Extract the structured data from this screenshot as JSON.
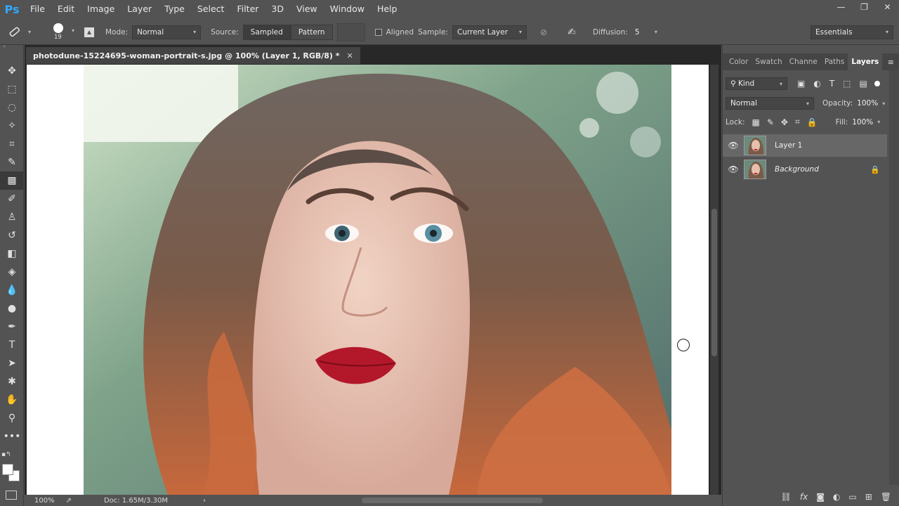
{
  "app": {
    "logo": "Ps"
  },
  "menu": [
    "File",
    "Edit",
    "Image",
    "Layer",
    "Type",
    "Select",
    "Filter",
    "3D",
    "View",
    "Window",
    "Help"
  ],
  "window_controls": {
    "minimize": "—",
    "maximize": "❐",
    "close": "✕"
  },
  "options": {
    "brush_size": "19",
    "mode_label": "Mode:",
    "mode_value": "Normal",
    "source_label": "Source:",
    "sampled": "Sampled",
    "pattern": "Pattern",
    "aligned_label": "Aligned",
    "sample_label": "Sample:",
    "sample_value": "Current Layer",
    "diffusion_label": "Diffusion:",
    "diffusion_value": "5",
    "workspace": "Essentials"
  },
  "tools": [
    {
      "name": "move-tool",
      "glyph": "✥"
    },
    {
      "name": "marquee-tool",
      "glyph": "⬚"
    },
    {
      "name": "lasso-tool",
      "glyph": "◌"
    },
    {
      "name": "quick-select-tool",
      "glyph": "✧"
    },
    {
      "name": "crop-tool",
      "glyph": "⌗"
    },
    {
      "name": "eyedropper-tool",
      "glyph": "✎"
    },
    {
      "name": "healing-brush-tool",
      "glyph": "▩"
    },
    {
      "name": "brush-tool",
      "glyph": "✐"
    },
    {
      "name": "clone-stamp-tool",
      "glyph": "♙"
    },
    {
      "name": "history-brush-tool",
      "glyph": "↺"
    },
    {
      "name": "eraser-tool",
      "glyph": "◧"
    },
    {
      "name": "paint-bucket-tool",
      "glyph": "◈"
    },
    {
      "name": "blur-tool",
      "glyph": "💧"
    },
    {
      "name": "dodge-tool",
      "glyph": "●"
    },
    {
      "name": "pen-tool",
      "glyph": "✒"
    },
    {
      "name": "type-tool",
      "glyph": "T"
    },
    {
      "name": "path-selection-tool",
      "glyph": "➤"
    },
    {
      "name": "custom-shape-tool",
      "glyph": "✱"
    },
    {
      "name": "hand-tool",
      "glyph": "✋"
    },
    {
      "name": "zoom-tool",
      "glyph": "⚲"
    },
    {
      "name": "more-tools",
      "glyph": "•••"
    }
  ],
  "document": {
    "tab_title": "photodune-15224695-woman-portrait-s.jpg @ 100% (Layer 1, RGB/8) *",
    "zoom": "100%",
    "doc_info": "Doc: 1.65M/3.30M"
  },
  "panel": {
    "tabs": [
      "Color",
      "Swatch",
      "Channe",
      "Paths",
      "Layers"
    ],
    "active_tab": "Layers",
    "kind_label": "Kind",
    "blend_mode": "Normal",
    "opacity_label": "Opacity:",
    "opacity_value": "100%",
    "lock_label": "Lock:",
    "fill_label": "Fill:",
    "fill_value": "100%",
    "layers": [
      {
        "name": "Layer 1",
        "selected": true,
        "locked": false
      },
      {
        "name": "Background",
        "selected": false,
        "locked": true
      }
    ]
  },
  "colors": {
    "accent": "#31a8ff",
    "ui_bg": "#535353",
    "canvas": "#282828"
  }
}
